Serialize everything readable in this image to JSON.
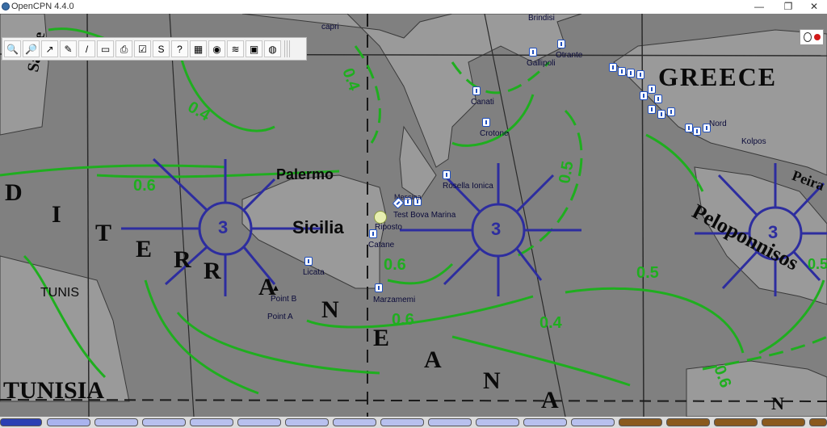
{
  "window": {
    "title": "OpenCPN 4.4.0",
    "minimize_glyph": "—",
    "maximize_glyph": "❐",
    "close_glyph": "✕"
  },
  "toolbar": {
    "tools": [
      {
        "name": "zoom-in-icon",
        "glyph": "🔍"
      },
      {
        "name": "zoom-out-icon",
        "glyph": "🔎"
      },
      {
        "name": "route-icon",
        "glyph": "↗"
      },
      {
        "name": "ais-icon",
        "glyph": "✎"
      },
      {
        "name": "measure-icon",
        "glyph": "/"
      },
      {
        "name": "chart-bar-icon",
        "glyph": "▭"
      },
      {
        "name": "print-icon",
        "glyph": "⎙"
      },
      {
        "name": "route-manager-icon",
        "glyph": "☑"
      },
      {
        "name": "track-icon",
        "glyph": "S"
      },
      {
        "name": "info-icon",
        "glyph": "?"
      },
      {
        "name": "weather-icon",
        "glyph": "▦"
      },
      {
        "name": "dashboard-icon",
        "glyph": "◉"
      },
      {
        "name": "layers-icon",
        "glyph": "≋"
      },
      {
        "name": "settings-icon",
        "glyph": "▣"
      },
      {
        "name": "globe-icon",
        "glyph": "◍"
      }
    ]
  },
  "map": {
    "labels": {
      "greece": "GREECE",
      "tunisia": "TUNISIA",
      "tunis": "TUNIS",
      "sicilia": "Sicilia",
      "palermo": "Palermo",
      "peloponnisos": "Peloponnisos",
      "mediterranean_letters": [
        "D",
        "I",
        "T",
        "E",
        "R",
        "R",
        "A",
        "N",
        "E",
        "A",
        "N",
        "A",
        "N"
      ],
      "sardegna": "Sarde",
      "peira": "Peira",
      "capri": "capri",
      "brindisi": "Brindisi"
    },
    "contour_values": [
      "0.4",
      "0.4",
      "0.6",
      "0.5",
      "0.6",
      "0.5",
      "0.6",
      "0.4",
      "0.6",
      "0.5"
    ],
    "rose_values": [
      "3",
      "3",
      "3"
    ],
    "waypoints": [
      {
        "label": "Gallipoli"
      },
      {
        "label": "Otrante"
      },
      {
        "label": "Canati"
      },
      {
        "label": "Crotone"
      },
      {
        "label": "Rosella Ionica"
      },
      {
        "label": "Messina"
      },
      {
        "label": "Test Bova Marina"
      },
      {
        "label": "Riposto"
      },
      {
        "label": "Catane"
      },
      {
        "label": "Licata"
      },
      {
        "label": "Marzamemi"
      },
      {
        "label": "Point B"
      },
      {
        "label": "Point A"
      },
      {
        "label": "Nord"
      },
      {
        "label": "Kolpos"
      }
    ]
  },
  "colors": {
    "contour_green": "#1fae1f",
    "rose_blue": "#2d2d9f",
    "waypoint_blue": "#1f4fbf",
    "piano_blue_active": "#2b3fb3",
    "piano_blue": "#a9b3ee",
    "piano_brown": "#8a5a1e"
  },
  "chart_bar": {
    "keys": [
      {
        "state": "active"
      },
      {
        "state": "selected"
      },
      {
        "state": "blue"
      },
      {
        "state": "blue"
      },
      {
        "state": "blue"
      },
      {
        "state": "blue"
      },
      {
        "state": "blue"
      },
      {
        "state": "blue"
      },
      {
        "state": "blue"
      },
      {
        "state": "blue"
      },
      {
        "state": "blue"
      },
      {
        "state": "blue"
      },
      {
        "state": "brown"
      },
      {
        "state": "brown"
      },
      {
        "state": "brown"
      },
      {
        "state": "brown"
      },
      {
        "state": "brown"
      },
      {
        "state": "brown"
      }
    ]
  }
}
